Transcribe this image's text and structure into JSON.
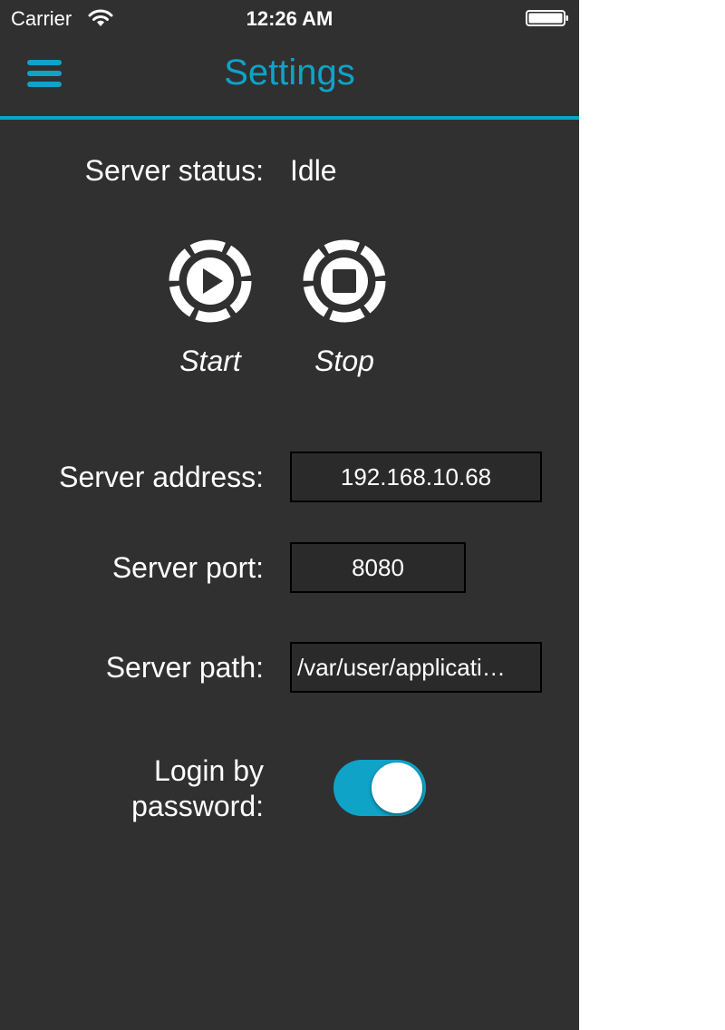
{
  "status_bar": {
    "carrier": "Carrier",
    "time": "12:26 AM",
    "wifi_icon": "wifi-icon",
    "battery_icon": "battery-icon"
  },
  "nav": {
    "title": "Settings",
    "menu_icon": "hamburger-menu-icon"
  },
  "server_status": {
    "label": "Server status:",
    "value": "Idle"
  },
  "controls": {
    "start": {
      "label": "Start",
      "icon": "play-icon"
    },
    "stop": {
      "label": "Stop",
      "icon": "stop-icon"
    }
  },
  "form": {
    "address": {
      "label": "Server address:",
      "value": "192.168.10.68"
    },
    "port": {
      "label": "Server port:",
      "value": "8080"
    },
    "path": {
      "label": "Server path:",
      "value": "/var/user/applicati…"
    },
    "login": {
      "label_line1": "Login by",
      "label_line2": "password:",
      "enabled": true
    }
  },
  "colors": {
    "accent": "#0fa3c8",
    "background": "#303030",
    "text": "#ffffff",
    "field_border": "#000000"
  }
}
